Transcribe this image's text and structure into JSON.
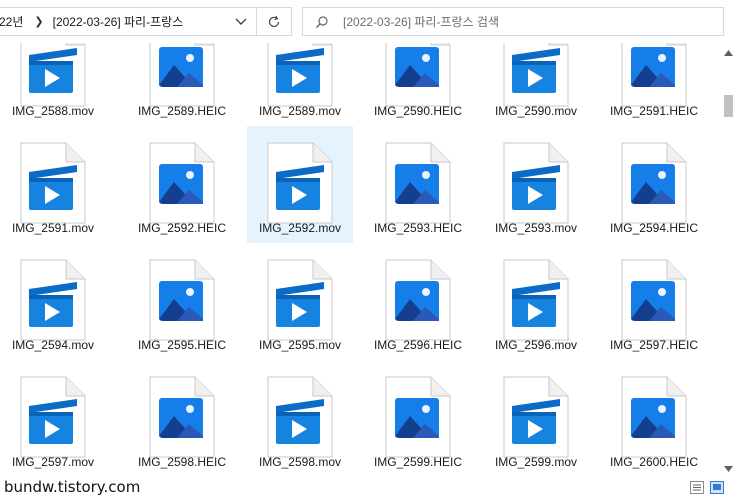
{
  "address": {
    "crumb_year": "22년",
    "crumb_folder": "[2022-03-26] 파리-프랑스"
  },
  "search": {
    "placeholder": "[2022-03-26] 파리-프랑스 검색"
  },
  "files": [
    {
      "name": "IMG_2588.mov",
      "type": "video"
    },
    {
      "name": "IMG_2589.HEIC",
      "type": "image"
    },
    {
      "name": "IMG_2589.mov",
      "type": "video"
    },
    {
      "name": "IMG_2590.HEIC",
      "type": "image"
    },
    {
      "name": "IMG_2590.mov",
      "type": "video"
    },
    {
      "name": "IMG_2591.HEIC",
      "type": "image"
    },
    {
      "name": "IMG_2591.mov",
      "type": "video"
    },
    {
      "name": "IMG_2592.HEIC",
      "type": "image"
    },
    {
      "name": "IMG_2592.mov",
      "type": "video",
      "selected": true
    },
    {
      "name": "IMG_2593.HEIC",
      "type": "image"
    },
    {
      "name": "IMG_2593.mov",
      "type": "video"
    },
    {
      "name": "IMG_2594.HEIC",
      "type": "image"
    },
    {
      "name": "IMG_2594.mov",
      "type": "video"
    },
    {
      "name": "IMG_2595.HEIC",
      "type": "image"
    },
    {
      "name": "IMG_2595.mov",
      "type": "video"
    },
    {
      "name": "IMG_2596.HEIC",
      "type": "image"
    },
    {
      "name": "IMG_2596.mov",
      "type": "video"
    },
    {
      "name": "IMG_2597.HEIC",
      "type": "image"
    },
    {
      "name": "IMG_2597.mov",
      "type": "video"
    },
    {
      "name": "IMG_2598.HEIC",
      "type": "image"
    },
    {
      "name": "IMG_2598.mov",
      "type": "video"
    },
    {
      "name": "IMG_2599.HEIC",
      "type": "image"
    },
    {
      "name": "IMG_2599.mov",
      "type": "video"
    },
    {
      "name": "IMG_2600.HEIC",
      "type": "image"
    }
  ],
  "watermark": "bundw.tistory.com",
  "icons": {
    "dropdown": "chevron-down-icon",
    "refresh": "refresh-icon",
    "search": "search-icon",
    "video": "video-file-icon",
    "image": "image-file-icon"
  },
  "colors": {
    "selection": "#e5f3ff",
    "video_blue": "#1170d6",
    "image_blue": "#2e7be0"
  }
}
